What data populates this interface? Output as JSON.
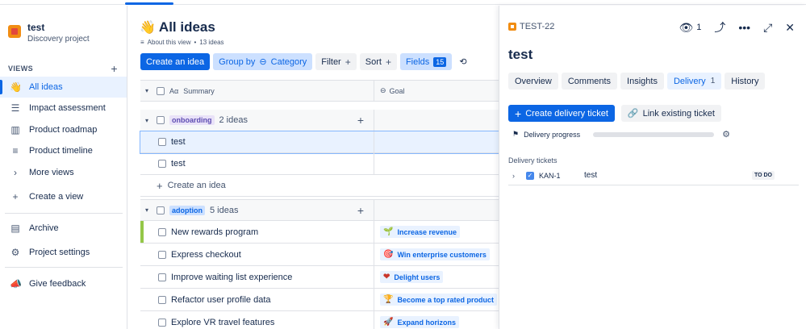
{
  "project": {
    "name": "test",
    "type": "Discovery project"
  },
  "sidebar": {
    "views_label": "VIEWS",
    "items": [
      {
        "label": "All ideas",
        "icon": "wave-icon"
      },
      {
        "label": "Impact assessment",
        "icon": "list-icon"
      },
      {
        "label": "Product roadmap",
        "icon": "board-icon"
      },
      {
        "label": "Product timeline",
        "icon": "timeline-icon"
      },
      {
        "label": "More views",
        "icon": "chevron-right-icon"
      },
      {
        "label": "Create a view",
        "icon": "plus-icon"
      }
    ],
    "archive": "Archive",
    "settings": "Project settings",
    "feedback": "Give feedback"
  },
  "main": {
    "title": "All ideas",
    "about": "About this view",
    "idea_count": "13 ideas",
    "toolbar": {
      "create": "Create an idea",
      "group_by": "Group by",
      "category": "Category",
      "filter": "Filter",
      "sort": "Sort",
      "fields": "Fields",
      "fields_count": "15"
    },
    "columns": {
      "summary": "Summary",
      "goal": "Goal"
    },
    "groups": [
      {
        "label": "onboarding",
        "count": "2 ideas",
        "rows": [
          "test",
          "test"
        ],
        "create": "Create an idea"
      },
      {
        "label": "adoption",
        "count": "5 ideas",
        "rows": [
          {
            "summary": "New rewards program",
            "goal": "Increase revenue"
          },
          {
            "summary": "Express checkout",
            "goal": "Win enterprise customers"
          },
          {
            "summary": "Improve waiting list experience",
            "goal": "Delight users"
          },
          {
            "summary": "Refactor user profile data",
            "goal": "Become a top rated product"
          },
          {
            "summary": "Explore VR travel features",
            "goal": "Expand horizons"
          }
        ]
      }
    ]
  },
  "panel": {
    "key": "TEST-22",
    "watchers": "1",
    "title": "test",
    "tabs": [
      {
        "label": "Overview"
      },
      {
        "label": "Comments"
      },
      {
        "label": "Insights"
      },
      {
        "label": "Delivery",
        "count": "1"
      },
      {
        "label": "History"
      }
    ],
    "create_ticket": "Create delivery ticket",
    "link_ticket": "Link existing ticket",
    "delivery_progress": "Delivery progress",
    "progress_fraction": 0,
    "tickets_label": "Delivery tickets",
    "ticket": {
      "key": "KAN-1",
      "summary": "test",
      "status": "TO DO"
    }
  }
}
